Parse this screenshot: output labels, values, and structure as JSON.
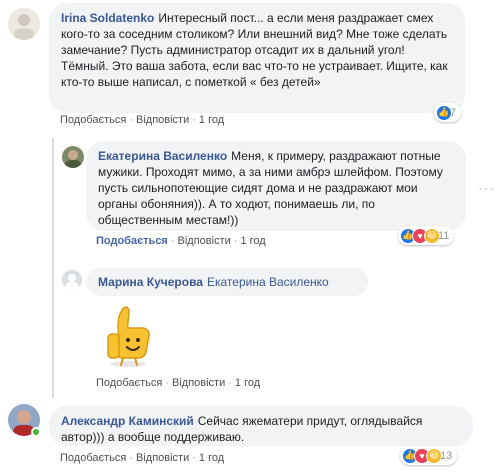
{
  "actions": {
    "like": "Подобається",
    "reply": "Відповісти",
    "separator": "·"
  },
  "comments": [
    {
      "author": "Irina Soldatenko",
      "text": "Интересный пост... а если меня раздражает смех кого-то за соседним столиком? Или внешний вид? Мне тоже сделать замечание? Пусть администратор отсадит их в дальний угол! Тёмный. Это ваша забота, если вас что-то не устраивает. Ищите, как кто-то выше написал, с пометкой « без детей»",
      "time": "1 год",
      "reaction_count": "7"
    },
    {
      "author": "Екатерина Василенко",
      "text": "Меня, к примеру, раздражают потные мужики. Проходят мимо, а за ними амбрэ шлейфом. Поэтому пусть сильнопотеющие сидят дома и не раздражают мои органы обоняния)). А то ходют, понимаешь ли, по общественным местам!))",
      "time": "1 год",
      "reaction_count": "11",
      "liked": true
    },
    {
      "author": "Марина Кучерова",
      "mention": "Екатерина Василенко",
      "time": "1 год",
      "sticker": "thumbs-up sticker"
    },
    {
      "author": "Александр Каминский",
      "text": "Сейчас яжематери придут, оглядывайся автор))) а вообще поддерживаю.",
      "time": "1 год",
      "reaction_count": "13"
    }
  ],
  "colors": {
    "link": "#385898",
    "bubble": "#f2f3f5",
    "meta": "#606770",
    "like_blue": "#1877f2",
    "online": "#42b72a"
  }
}
